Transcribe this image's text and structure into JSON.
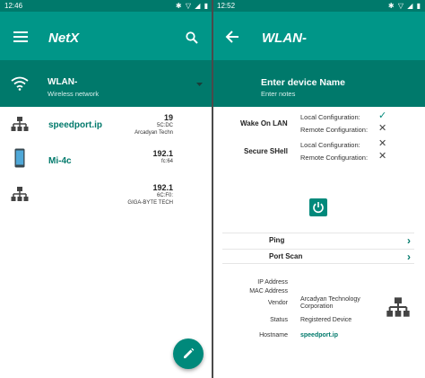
{
  "left": {
    "status_time": "12:46",
    "status_icons": "✱ ▽ ◢ ▮",
    "app_title": "NetX",
    "network": {
      "name": "WLAN-",
      "type": "Wireless network"
    },
    "devices": [
      {
        "name": "speedport.ip",
        "ip": "19",
        "mac": "5C:DC",
        "vendor": "Arcadyan Techn",
        "icon": "network-hub-icon"
      },
      {
        "name": "Mi-4c",
        "ip": "192.1",
        "mac": "fc:64",
        "vendor": "",
        "icon": "smartphone-icon"
      },
      {
        "name": "",
        "ip": "192.1",
        "mac": "6C:F0:",
        "vendor": "GIGA-BYTE TECH",
        "icon": "network-hub-icon"
      }
    ]
  },
  "right": {
    "status_time": "12:52",
    "status_icons": "✱ ▽ ◢ ▮",
    "screen_title": "WLAN-",
    "device_name_placeholder": "Enter device Name",
    "notes_placeholder": "Enter notes",
    "features": [
      {
        "label": "Wake On LAN",
        "local_label": "Local Configuration:",
        "local": "✓",
        "remote_label": "Remote Configuration:",
        "remote": "✕"
      },
      {
        "label": "Secure SHell",
        "local_label": "Local Configuration:",
        "local": "✕",
        "remote_label": "Remote Configuration:",
        "remote": "✕"
      }
    ],
    "actions": [
      "Ping",
      "Port Scan"
    ],
    "details": {
      "ip_label": "IP Address",
      "mac_label": "MAC Address",
      "vendor_label": "Vendor",
      "vendor_value": "Arcadyan Technology Corporation",
      "status_label": "Status",
      "status_value": "Registered Device",
      "hostname_label": "Hostname",
      "hostname_value": "speedport.ip"
    }
  },
  "colors": {
    "primary": "#009688",
    "primary_dark": "#00796b",
    "accent": "#00897b"
  }
}
